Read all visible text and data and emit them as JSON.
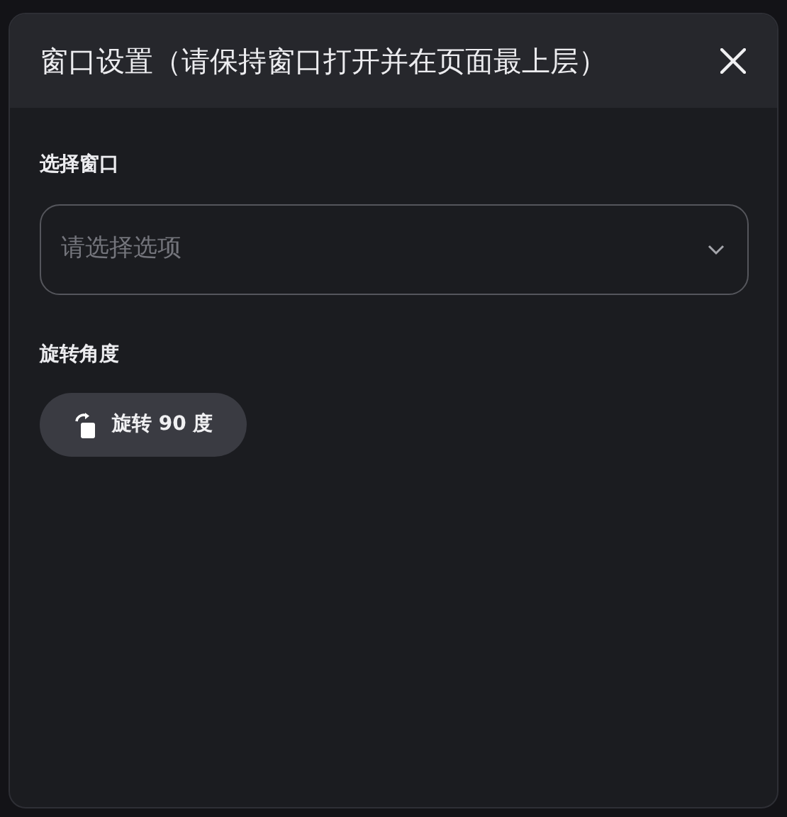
{
  "dialog": {
    "title": "窗口设置（请保持窗口打开并在页面最上层）",
    "window_select": {
      "label": "选择窗口",
      "placeholder": "请选择选项"
    },
    "rotation": {
      "label": "旋转角度",
      "button": "旋转 90 度"
    }
  }
}
